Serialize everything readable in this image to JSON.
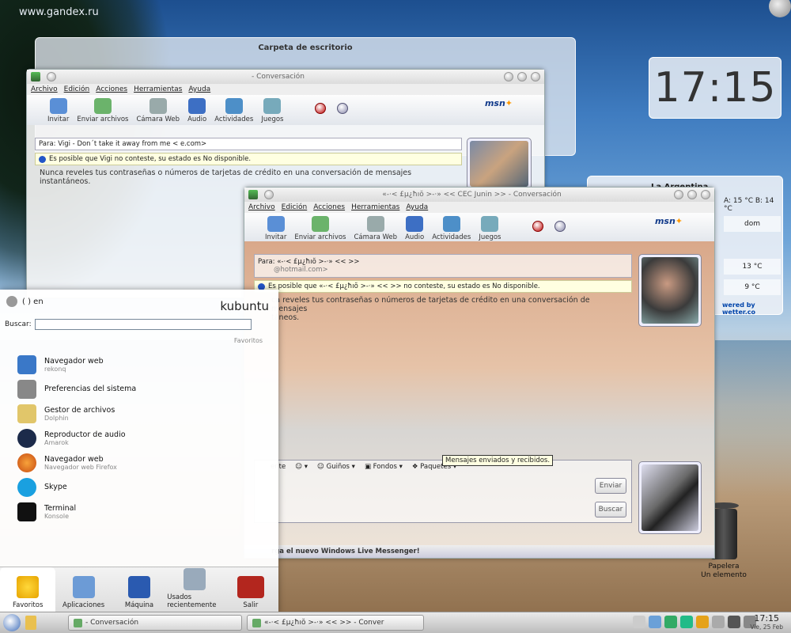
{
  "desktop": {
    "watermark": "www.gandex.ru",
    "folder_view_title": "Carpeta de escritorio",
    "clock": "17:15",
    "weather": {
      "city": "La Argentina",
      "temps": "A: 15 °C B: 14 °C",
      "rows": [
        "dom",
        "13 °C",
        "9 °C"
      ],
      "powered": "wered by wetter.co"
    },
    "trash": {
      "label": "Papelera",
      "sub": "Un elemento"
    }
  },
  "window1": {
    "title": "- Conversación",
    "menu": [
      "Archivo",
      "Edición",
      "Acciones",
      "Herramientas",
      "Ayuda"
    ],
    "tools": [
      "Invitar",
      "Enviar archivos",
      "Cámara Web",
      "Audio",
      "Actividades",
      "Juegos"
    ],
    "to_line": "Para:  Vigi - Don´t take it away from me <                    e.com>",
    "warning": "Es posible que Vigi no conteste, su estado es No disponible.",
    "notice": "Nunca reveles tus contraseñas o números de tarjetas de crédito en una conversación de mensajes instantáneos."
  },
  "window2": {
    "title": "«-·< £µ¿ħıŏ >-·»       << CEC Junin >> - Conversación",
    "menu": [
      "Archivo",
      "Edición",
      "Acciones",
      "Herramientas",
      "Ayuda"
    ],
    "tools": [
      "Invitar",
      "Enviar archivos",
      "Cámara Web",
      "Audio",
      "Actividades",
      "Juegos"
    ],
    "to_line": "Para:  «-·< £µ¿ħıŏ >-·»      <<            >>",
    "email": "@hotmail.com>",
    "warning": "Es posible que «-·< £µ¿ħıŏ >-·»      <<            >> no conteste, su estado es No disponible.",
    "notice": "ca reveles tus contraseñas o números de tarjetas de crédito en una conversación de mensajes\ntáneos.",
    "input_tools": [
      "ente",
      "Guiños",
      "Fondos",
      "Paquetes"
    ],
    "tooltip": "Mensajes enviados y recibidos.",
    "send": "Enviar",
    "search": "Buscar",
    "live_banner": "rga el nuevo Windows Live Messenger!"
  },
  "kickoff": {
    "user": "(      ) en",
    "brand": "kubuntu",
    "search_label": "Buscar:",
    "search_value": "",
    "favorites_header": "Favoritos",
    "items": [
      {
        "title": "Navegador web",
        "sub": "rekonq"
      },
      {
        "title": "Preferencias del sistema",
        "sub": ""
      },
      {
        "title": "Gestor de archivos",
        "sub": "Dolphin"
      },
      {
        "title": "Reproductor de audio",
        "sub": "Amarok"
      },
      {
        "title": "Navegador web",
        "sub": "Navegador web Firefox"
      },
      {
        "title": "Skype",
        "sub": ""
      },
      {
        "title": "Terminal",
        "sub": "Konsole"
      }
    ],
    "tabs": [
      "Favoritos",
      "Aplicaciones",
      "Máquina",
      "Usados recientemente",
      "Salir"
    ]
  },
  "taskbar": {
    "tasks": [
      "- Conversación",
      "«-·< £µ¿ħıŏ >-·»      <<            >> - Conver"
    ],
    "time": "17:15",
    "date": "Vie, 25 Feb"
  }
}
